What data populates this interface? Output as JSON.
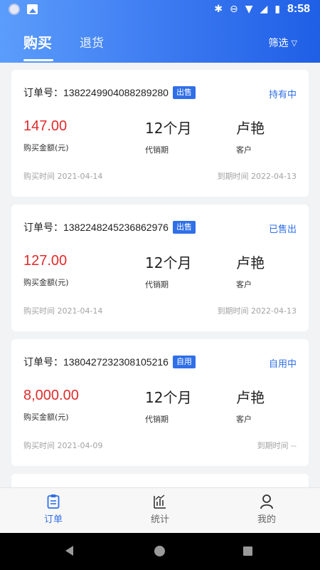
{
  "status_bar": {
    "time": "8:58"
  },
  "header": {
    "tabs": [
      {
        "label": "购买",
        "active": true
      },
      {
        "label": "退货",
        "active": false
      }
    ],
    "filter_label": "筛选",
    "filter_icon": "funnel-icon"
  },
  "orders": [
    {
      "order_label": "订单号：",
      "order_no": "1382249904088289280",
      "badge": "出售",
      "status": "持有中",
      "amount": "147.00",
      "amount_label": "购买金额(元)",
      "period": "12个月",
      "period_label": "代销期",
      "customer": "卢艳",
      "customer_label": "客户",
      "buy_time": "购买时间 2021-04-14",
      "expire_time": "到期时间 2022-04-13"
    },
    {
      "order_label": "订单号：",
      "order_no": "1382248245236862976",
      "badge": "出售",
      "status": "已售出",
      "amount": "127.00",
      "amount_label": "购买金额(元)",
      "period": "12个月",
      "period_label": "代销期",
      "customer": "卢艳",
      "customer_label": "客户",
      "buy_time": "购买时间 2021-04-14",
      "expire_time": "到期时间 2022-04-13"
    },
    {
      "order_label": "订单号：",
      "order_no": "1380427232308105216",
      "badge": "自用",
      "status": "自用中",
      "amount": "8,000.00",
      "amount_label": "购买金额(元)",
      "period": "12个月",
      "period_label": "代销期",
      "customer": "卢艳",
      "customer_label": "客户",
      "buy_time": "购买时间 2021-04-09",
      "expire_time": "到期时间 --"
    }
  ],
  "bottom_nav": [
    {
      "label": "订单",
      "icon": "clipboard-icon",
      "active": true
    },
    {
      "label": "统计",
      "icon": "bar-chart-icon",
      "active": false
    },
    {
      "label": "我的",
      "icon": "person-icon",
      "active": false
    }
  ],
  "colors": {
    "accent": "#2f6fe8",
    "amount": "#e02a2a",
    "header_gradient_start": "#5b9dfb",
    "header_gradient_end": "#1f5fe6"
  }
}
